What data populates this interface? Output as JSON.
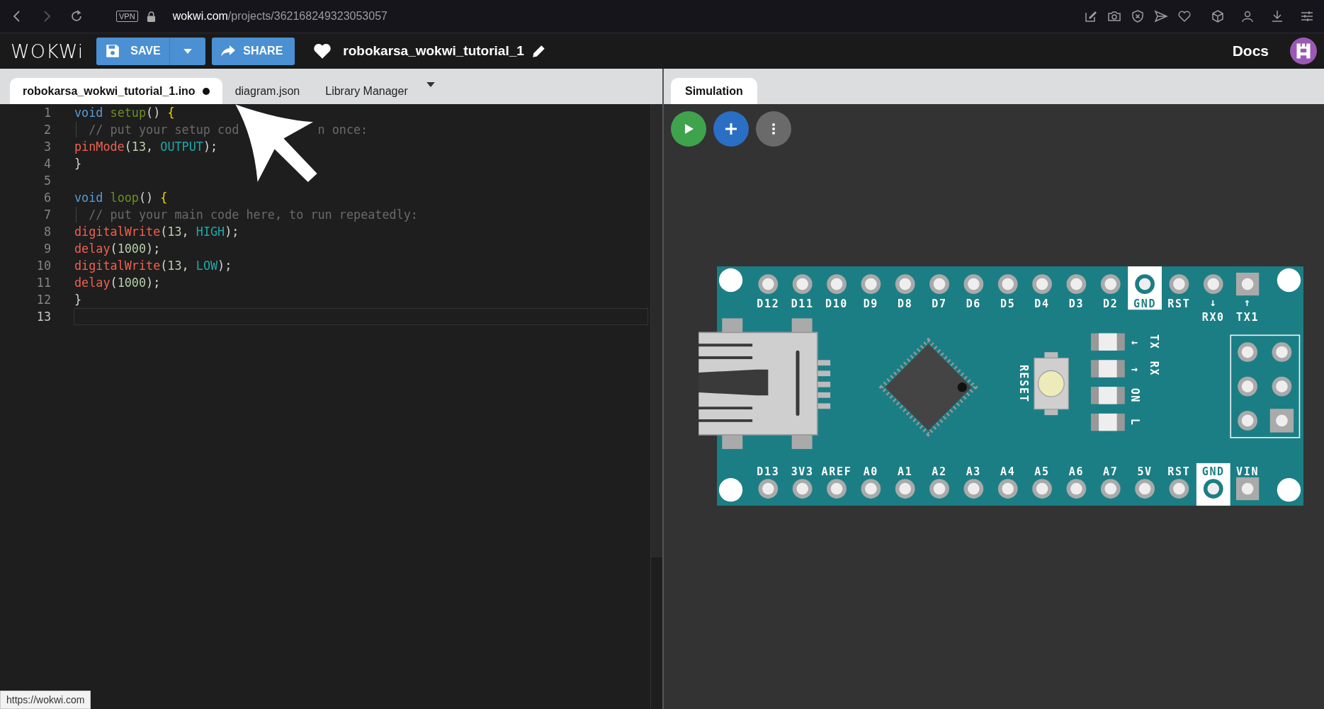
{
  "browser": {
    "vpn_label": "VPN",
    "url_host": "wokwi.com",
    "url_path": "/projects/362168249323053057"
  },
  "header": {
    "logo": "WOKWi",
    "save_label": "SAVE",
    "share_label": "SHARE",
    "project_name": "robokarsa_wokwi_tutorial_1",
    "docs_label": "Docs"
  },
  "editor_tabs": [
    {
      "label": "robokarsa_wokwi_tutorial_1.ino",
      "selected": true,
      "modified": true
    },
    {
      "label": "diagram.json",
      "selected": false,
      "modified": false
    },
    {
      "label": "Library Manager",
      "selected": false,
      "modified": false
    }
  ],
  "code_lines": [
    {
      "number": "1",
      "current": false,
      "indent_guide": false,
      "tokens": [
        {
          "text": "void ",
          "kind": "keyword"
        },
        {
          "text": "setup",
          "kind": "function"
        },
        {
          "text": "() ",
          "kind": "punct"
        },
        {
          "text": "{",
          "kind": "brace"
        }
      ]
    },
    {
      "number": "2",
      "current": false,
      "indent_guide": true,
      "tokens": [
        {
          "text": "  // put your setup cod",
          "kind": "comment"
        },
        {
          "text": "n once:",
          "kind": "comment",
          "after_gap": true
        }
      ]
    },
    {
      "number": "3",
      "current": false,
      "indent_guide": false,
      "tokens": [
        {
          "text": "pinMode",
          "kind": "call"
        },
        {
          "text": "(",
          "kind": "punct"
        },
        {
          "text": "13",
          "kind": "number"
        },
        {
          "text": ", ",
          "kind": "punct"
        },
        {
          "text": "OUTPUT",
          "kind": "constant"
        },
        {
          "text": ");",
          "kind": "punct"
        }
      ]
    },
    {
      "number": "4",
      "current": false,
      "indent_guide": false,
      "tokens": [
        {
          "text": "}",
          "kind": "punct"
        }
      ]
    },
    {
      "number": "5",
      "current": false,
      "indent_guide": false
    },
    {
      "number": "6",
      "current": false,
      "indent_guide": false,
      "tokens": [
        {
          "text": "void ",
          "kind": "keyword"
        },
        {
          "text": "loop",
          "kind": "function"
        },
        {
          "text": "() ",
          "kind": "punct"
        },
        {
          "text": "{",
          "kind": "brace"
        }
      ]
    },
    {
      "number": "7",
      "current": false,
      "indent_guide": true,
      "tokens": [
        {
          "text": "  // put your main code here, to run repeatedly:",
          "kind": "comment"
        }
      ]
    },
    {
      "number": "8",
      "current": false,
      "indent_guide": false,
      "tokens": [
        {
          "text": "digitalWrite",
          "kind": "call"
        },
        {
          "text": "(",
          "kind": "punct"
        },
        {
          "text": "13",
          "kind": "number"
        },
        {
          "text": ", ",
          "kind": "punct"
        },
        {
          "text": "HIGH",
          "kind": "constant"
        },
        {
          "text": ");",
          "kind": "punct"
        }
      ]
    },
    {
      "number": "9",
      "current": false,
      "indent_guide": false,
      "tokens": [
        {
          "text": "delay",
          "kind": "call"
        },
        {
          "text": "(",
          "kind": "punct"
        },
        {
          "text": "1000",
          "kind": "number"
        },
        {
          "text": ");",
          "kind": "punct"
        }
      ]
    },
    {
      "number": "10",
      "current": false,
      "indent_guide": false,
      "tokens": [
        {
          "text": "digitalWrite",
          "kind": "call"
        },
        {
          "text": "(",
          "kind": "punct"
        },
        {
          "text": "13",
          "kind": "number"
        },
        {
          "text": ", ",
          "kind": "punct"
        },
        {
          "text": "LOW",
          "kind": "constant"
        },
        {
          "text": ");",
          "kind": "punct"
        }
      ]
    },
    {
      "number": "11",
      "current": false,
      "indent_guide": false,
      "tokens": [
        {
          "text": "delay",
          "kind": "call"
        },
        {
          "text": "(",
          "kind": "punct"
        },
        {
          "text": "1000",
          "kind": "number"
        },
        {
          "text": ");",
          "kind": "punct"
        }
      ]
    },
    {
      "number": "12",
      "current": false,
      "indent_guide": false,
      "tokens": [
        {
          "text": "}",
          "kind": "punct"
        }
      ]
    },
    {
      "number": "13",
      "current": true,
      "indent_guide": false
    }
  ],
  "simulation_tab": {
    "label": "Simulation",
    "selected": true
  },
  "board": {
    "top_pins": [
      {
        "label": "D12",
        "highlighted": false,
        "square": false
      },
      {
        "label": "D11",
        "highlighted": false,
        "square": false
      },
      {
        "label": "D10",
        "highlighted": false,
        "square": false
      },
      {
        "label": "D9",
        "highlighted": false,
        "square": false
      },
      {
        "label": "D8",
        "highlighted": false,
        "square": false
      },
      {
        "label": "D7",
        "highlighted": false,
        "square": false
      },
      {
        "label": "D6",
        "highlighted": false,
        "square": false
      },
      {
        "label": "D5",
        "highlighted": false,
        "square": false
      },
      {
        "label": "D4",
        "highlighted": false,
        "square": false
      },
      {
        "label": "D3",
        "highlighted": false,
        "square": false
      },
      {
        "label": "D2",
        "highlighted": false,
        "square": false
      },
      {
        "label": "GND",
        "highlighted": true,
        "square": false
      },
      {
        "label": "RST",
        "highlighted": false,
        "square": false
      },
      {
        "label": "RX0",
        "arrow": "↓",
        "highlighted": false,
        "square": false
      },
      {
        "label": "TX1",
        "arrow": "↑",
        "highlighted": false,
        "square": true
      }
    ],
    "bottom_pins": [
      {
        "label": "D13",
        "highlighted": false,
        "square": false
      },
      {
        "label": "3V3",
        "highlighted": false,
        "square": false
      },
      {
        "label": "AREF",
        "highlighted": false,
        "square": false
      },
      {
        "label": "A0",
        "highlighted": false,
        "square": false
      },
      {
        "label": "A1",
        "highlighted": false,
        "square": false
      },
      {
        "label": "A2",
        "highlighted": false,
        "square": false
      },
      {
        "label": "A3",
        "highlighted": false,
        "square": false
      },
      {
        "label": "A4",
        "highlighted": false,
        "square": false
      },
      {
        "label": "A5",
        "highlighted": false,
        "square": false
      },
      {
        "label": "A6",
        "highlighted": false,
        "square": false
      },
      {
        "label": "A7",
        "highlighted": false,
        "square": false
      },
      {
        "label": "5V",
        "highlighted": false,
        "square": false
      },
      {
        "label": "RST",
        "highlighted": false,
        "square": false
      },
      {
        "label": "GND",
        "highlighted": true,
        "square": false
      },
      {
        "label": "VIN",
        "highlighted": false,
        "square": true
      }
    ],
    "reset_label": "RESET",
    "leds": [
      {
        "label": "TX",
        "arrow": "←"
      },
      {
        "label": "RX",
        "arrow": "→"
      },
      {
        "label": "ON"
      },
      {
        "label": "L"
      }
    ]
  },
  "status_url": "https://wokwi.com"
}
